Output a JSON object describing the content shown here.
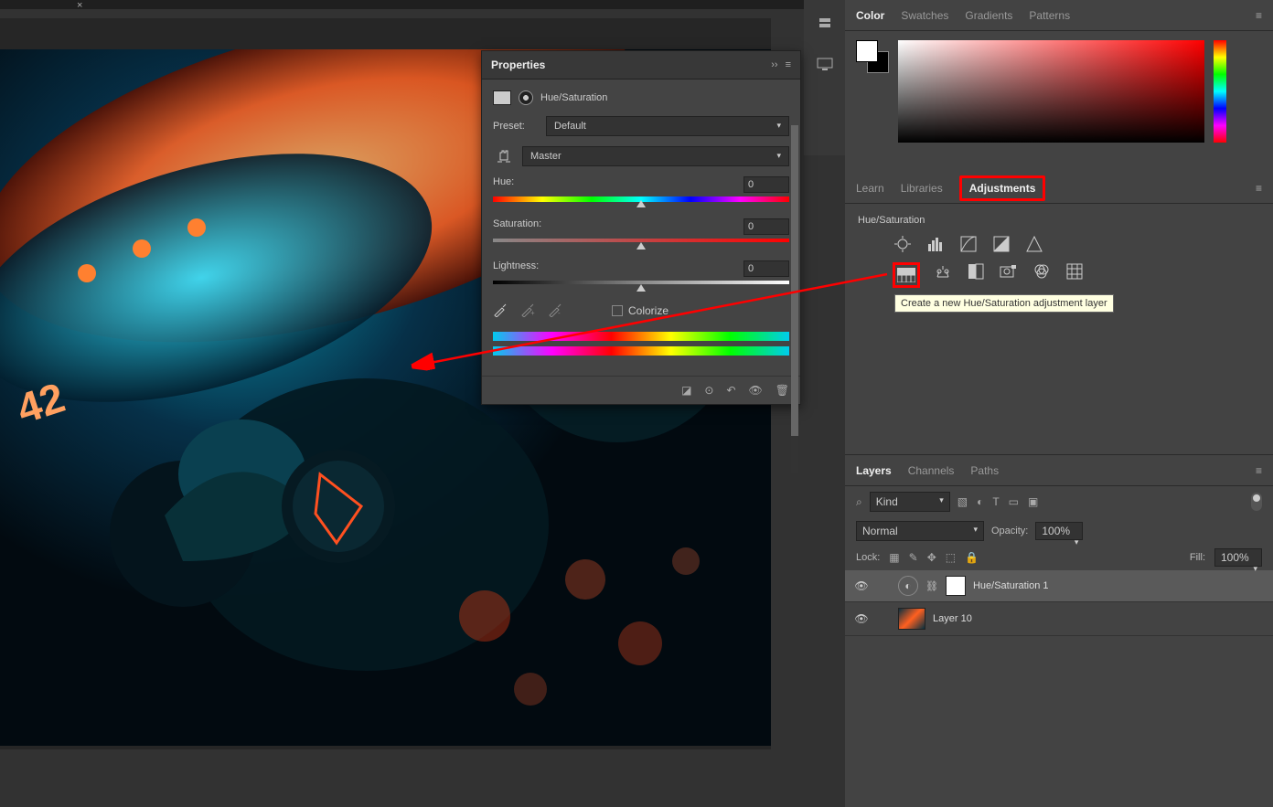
{
  "tabbar": {
    "close": "×"
  },
  "color_panel": {
    "tabs": {
      "color": "Color",
      "swatches": "Swatches",
      "gradients": "Gradients",
      "patterns": "Patterns"
    }
  },
  "adjustments_panel": {
    "tabs": {
      "learn": "Learn",
      "libraries": "Libraries",
      "adjustments": "Adjustments"
    },
    "heading": "Hue/Saturation",
    "tooltip": "Create a new Hue/Saturation adjustment layer"
  },
  "layers_panel": {
    "tabs": {
      "layers": "Layers",
      "channels": "Channels",
      "paths": "Paths"
    },
    "filter": {
      "label": "Kind"
    },
    "blend_mode": "Normal",
    "opacity_label": "Opacity:",
    "opacity_value": "100%",
    "lock_label": "Lock:",
    "fill_label": "Fill:",
    "fill_value": "100%",
    "layers": [
      {
        "name": "Hue/Saturation 1"
      },
      {
        "name": "Layer 10"
      }
    ]
  },
  "properties": {
    "title": "Properties",
    "type_label": "Hue/Saturation",
    "preset_label": "Preset:",
    "preset_value": "Default",
    "range_value": "Master",
    "hue_label": "Hue:",
    "hue_value": "0",
    "saturation_label": "Saturation:",
    "saturation_value": "0",
    "lightness_label": "Lightness:",
    "lightness_value": "0",
    "colorize_label": "Colorize"
  }
}
